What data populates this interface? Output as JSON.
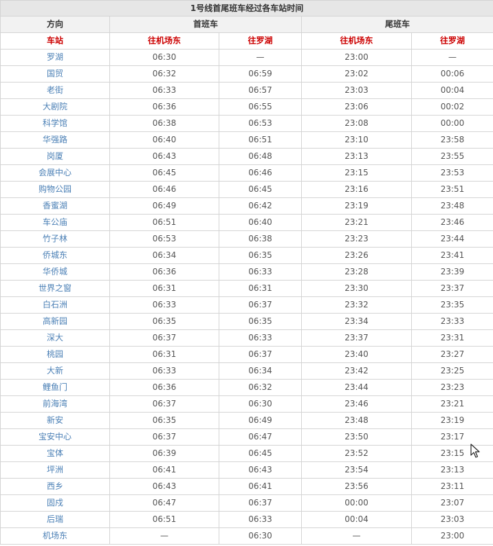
{
  "table": {
    "title": "1号线首尾班车经过各车站时间",
    "header_direction": "方向",
    "header_first_train": "首班车",
    "header_last_train": "尾班车",
    "header_station": "车站",
    "header_to_airport_east": "往机场东",
    "header_to_luohu": "往罗湖",
    "header_to_airport_east_2": "往机场东",
    "header_to_luohu_2": "往罗湖",
    "rows": [
      {
        "station": "罗湖",
        "first_airport": "06:30",
        "first_luohu": "—",
        "last_airport": "23:00",
        "last_luohu": "—"
      },
      {
        "station": "国贸",
        "first_airport": "06:32",
        "first_luohu": "06:59",
        "last_airport": "23:02",
        "last_luohu": "00:06"
      },
      {
        "station": "老街",
        "first_airport": "06:33",
        "first_luohu": "06:57",
        "last_airport": "23:03",
        "last_luohu": "00:04"
      },
      {
        "station": "大剧院",
        "first_airport": "06:36",
        "first_luohu": "06:55",
        "last_airport": "23:06",
        "last_luohu": "00:02"
      },
      {
        "station": "科学馆",
        "first_airport": "06:38",
        "first_luohu": "06:53",
        "last_airport": "23:08",
        "last_luohu": "00:00"
      },
      {
        "station": "华强路",
        "first_airport": "06:40",
        "first_luohu": "06:51",
        "last_airport": "23:10",
        "last_luohu": "23:58"
      },
      {
        "station": "岗厦",
        "first_airport": "06:43",
        "first_luohu": "06:48",
        "last_airport": "23:13",
        "last_luohu": "23:55"
      },
      {
        "station": "会展中心",
        "first_airport": "06:45",
        "first_luohu": "06:46",
        "last_airport": "23:15",
        "last_luohu": "23:53"
      },
      {
        "station": "购物公园",
        "first_airport": "06:46",
        "first_luohu": "06:45",
        "last_airport": "23:16",
        "last_luohu": "23:51"
      },
      {
        "station": "香蜜湖",
        "first_airport": "06:49",
        "first_luohu": "06:42",
        "last_airport": "23:19",
        "last_luohu": "23:48"
      },
      {
        "station": "车公庙",
        "first_airport": "06:51",
        "first_luohu": "06:40",
        "last_airport": "23:21",
        "last_luohu": "23:46"
      },
      {
        "station": "竹子林",
        "first_airport": "06:53",
        "first_luohu": "06:38",
        "last_airport": "23:23",
        "last_luohu": "23:44"
      },
      {
        "station": "侨城东",
        "first_airport": "06:34",
        "first_luohu": "06:35",
        "last_airport": "23:26",
        "last_luohu": "23:41"
      },
      {
        "station": "华侨城",
        "first_airport": "06:36",
        "first_luohu": "06:33",
        "last_airport": "23:28",
        "last_luohu": "23:39"
      },
      {
        "station": "世界之窗",
        "first_airport": "06:31",
        "first_luohu": "06:31",
        "last_airport": "23:30",
        "last_luohu": "23:37"
      },
      {
        "station": "白石洲",
        "first_airport": "06:33",
        "first_luohu": "06:37",
        "last_airport": "23:32",
        "last_luohu": "23:35"
      },
      {
        "station": "高新园",
        "first_airport": "06:35",
        "first_luohu": "06:35",
        "last_airport": "23:34",
        "last_luohu": "23:33"
      },
      {
        "station": "深大",
        "first_airport": "06:37",
        "first_luohu": "06:33",
        "last_airport": "23:37",
        "last_luohu": "23:31"
      },
      {
        "station": "桃园",
        "first_airport": "06:31",
        "first_luohu": "06:37",
        "last_airport": "23:40",
        "last_luohu": "23:27"
      },
      {
        "station": "大新",
        "first_airport": "06:33",
        "first_luohu": "06:34",
        "last_airport": "23:42",
        "last_luohu": "23:25"
      },
      {
        "station": "鲤鱼门",
        "first_airport": "06:36",
        "first_luohu": "06:32",
        "last_airport": "23:44",
        "last_luohu": "23:23"
      },
      {
        "station": "前海湾",
        "first_airport": "06:37",
        "first_luohu": "06:30",
        "last_airport": "23:46",
        "last_luohu": "23:21"
      },
      {
        "station": "新安",
        "first_airport": "06:35",
        "first_luohu": "06:49",
        "last_airport": "23:48",
        "last_luohu": "23:19"
      },
      {
        "station": "宝安中心",
        "first_airport": "06:37",
        "first_luohu": "06:47",
        "last_airport": "23:50",
        "last_luohu": "23:17"
      },
      {
        "station": "宝体",
        "first_airport": "06:39",
        "first_luohu": "06:45",
        "last_airport": "23:52",
        "last_luohu": "23:15"
      },
      {
        "station": "坪洲",
        "first_airport": "06:41",
        "first_luohu": "06:43",
        "last_airport": "23:54",
        "last_luohu": "23:13"
      },
      {
        "station": "西乡",
        "first_airport": "06:43",
        "first_luohu": "06:41",
        "last_airport": "23:56",
        "last_luohu": "23:11"
      },
      {
        "station": "固戍",
        "first_airport": "06:47",
        "first_luohu": "06:37",
        "last_airport": "00:00",
        "last_luohu": "23:07"
      },
      {
        "station": "后瑞",
        "first_airport": "06:51",
        "first_luohu": "06:33",
        "last_airport": "00:04",
        "last_luohu": "23:03"
      },
      {
        "station": "机场东",
        "first_airport": "—",
        "first_luohu": "06:30",
        "last_airport": "—",
        "last_luohu": "23:00"
      }
    ]
  },
  "cursor": {
    "icon": "mouse-pointer-icon"
  }
}
